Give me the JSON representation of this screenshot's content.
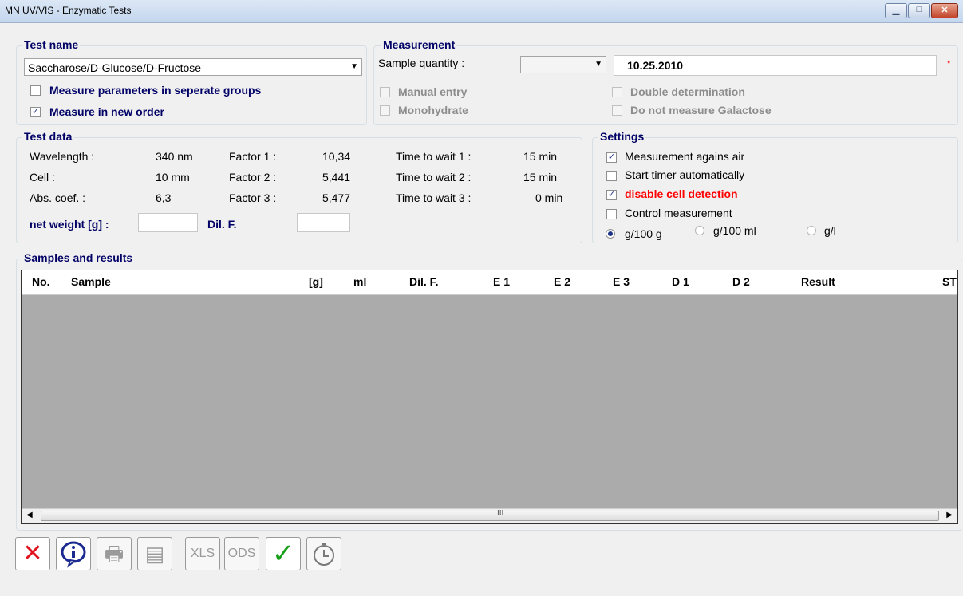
{
  "window": {
    "title": "MN UV/VIS - Enzymatic Tests"
  },
  "test_name": {
    "legend": "Test name",
    "selected": "Saccharose/D-Glucose/D-Fructose",
    "opt_separate_groups": "Measure parameters in seperate groups",
    "opt_new_order": "Measure in new order"
  },
  "measurement": {
    "legend": "Measurement",
    "sample_quantity_label": "Sample quantity :",
    "date_value": "10.25.2010",
    "required_mark": "*",
    "manual_entry": "Manual entry",
    "monohydrate": "Monohydrate",
    "double_determination": "Double determination",
    "no_galactose": "Do not measure Galactose"
  },
  "test_data": {
    "legend": "Test data",
    "wavelength_label": "Wavelength :",
    "wavelength_value": "340 nm",
    "cell_label": "Cell :",
    "cell_value": "10 mm",
    "abs_label": "Abs. coef. :",
    "abs_value": "6,3",
    "factor1_label": "Factor 1 :",
    "factor1_value": "10,34",
    "factor2_label": "Factor 2 :",
    "factor2_value": "5,441",
    "factor3_label": "Factor 3 :",
    "factor3_value": "5,477",
    "wait1_label": "Time to wait 1 :",
    "wait1_value": "15 min",
    "wait2_label": "Time to wait 2 :",
    "wait2_value": "15 min",
    "wait3_label": "Time to wait 3 :",
    "wait3_value": "0 min",
    "net_weight_label": "net weight [g] :",
    "dil_label": "Dil. F."
  },
  "settings": {
    "legend": "Settings",
    "against_air": "Measurement agains air",
    "start_timer": "Start timer automatically",
    "disable_cell": "disable cell detection",
    "control": "Control measurement",
    "unit_g100g": "g/100 g",
    "unit_g100ml": "g/100 ml",
    "unit_gl": "g/l"
  },
  "samples": {
    "legend": "Samples and results",
    "columns": [
      "No.",
      "Sample",
      "[g]",
      "ml",
      "Dil. F.",
      "E 1",
      "E 2",
      "E 3",
      "D 1",
      "D 2",
      "Result",
      "ST"
    ]
  },
  "toolbar": {
    "icons": [
      "close-icon",
      "info-icon",
      "print-icon",
      "report-icon",
      "xls-export-icon",
      "ods-export-icon",
      "confirm-icon",
      "timer-icon"
    ]
  }
}
